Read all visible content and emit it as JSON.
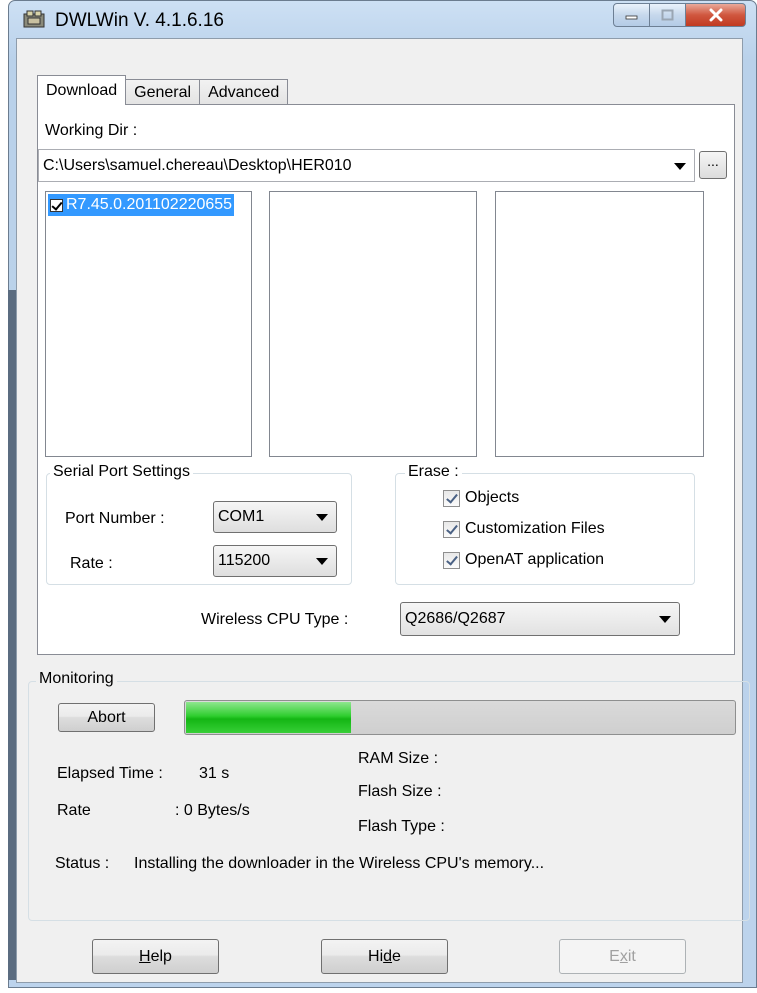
{
  "window": {
    "title": "DWLWin V. 4.1.6.16"
  },
  "tabs": [
    {
      "label": "Download",
      "active": true
    },
    {
      "label": "General",
      "active": false
    },
    {
      "label": "Advanced",
      "active": false
    }
  ],
  "download": {
    "working_dir_label": "Working Dir :",
    "working_dir_value": "C:\\Users\\samuel.chereau\\Desktop\\HER010",
    "browse_label": "...",
    "file_list": [
      {
        "label": "R7.45.0.201102220655",
        "checked": true
      }
    ],
    "serial": {
      "title": "Serial Port Settings",
      "port_label": "Port Number :",
      "port_value": "COM1",
      "rate_label": "Rate :",
      "rate_value": "115200"
    },
    "erase": {
      "title": "Erase :",
      "options": [
        {
          "label": "Objects",
          "checked": true
        },
        {
          "label": "Customization Files",
          "checked": true
        },
        {
          "label": "OpenAT application",
          "checked": true
        }
      ]
    },
    "cpu_type_label": "Wireless CPU Type :",
    "cpu_type_value": "Q2686/Q2687"
  },
  "monitoring": {
    "title": "Monitoring",
    "abort_label": "Abort",
    "progress": 0.3,
    "elapsed_label": "Elapsed Time :",
    "elapsed_value": "31 s",
    "rate_label": "Rate",
    "rate_value": ": 0 Bytes/s",
    "ram_label": "RAM Size :",
    "flash_size_label": "Flash Size :",
    "flash_type_label": "Flash Type :",
    "status_label": "Status :",
    "status_value": "Installing the downloader in the Wireless CPU's memory..."
  },
  "footer": {
    "help_prefix": "H",
    "help_rest": "elp",
    "hide_prefix": "Hi",
    "hide_mnemonic": "d",
    "hide_rest": "e",
    "exit_prefix": "E",
    "exit_mnemonic": "x",
    "exit_rest": "it",
    "exit_enabled": false
  },
  "colors": {
    "selection": "#3399ff",
    "progress": "#14b614",
    "close_button": "#c13a21"
  }
}
